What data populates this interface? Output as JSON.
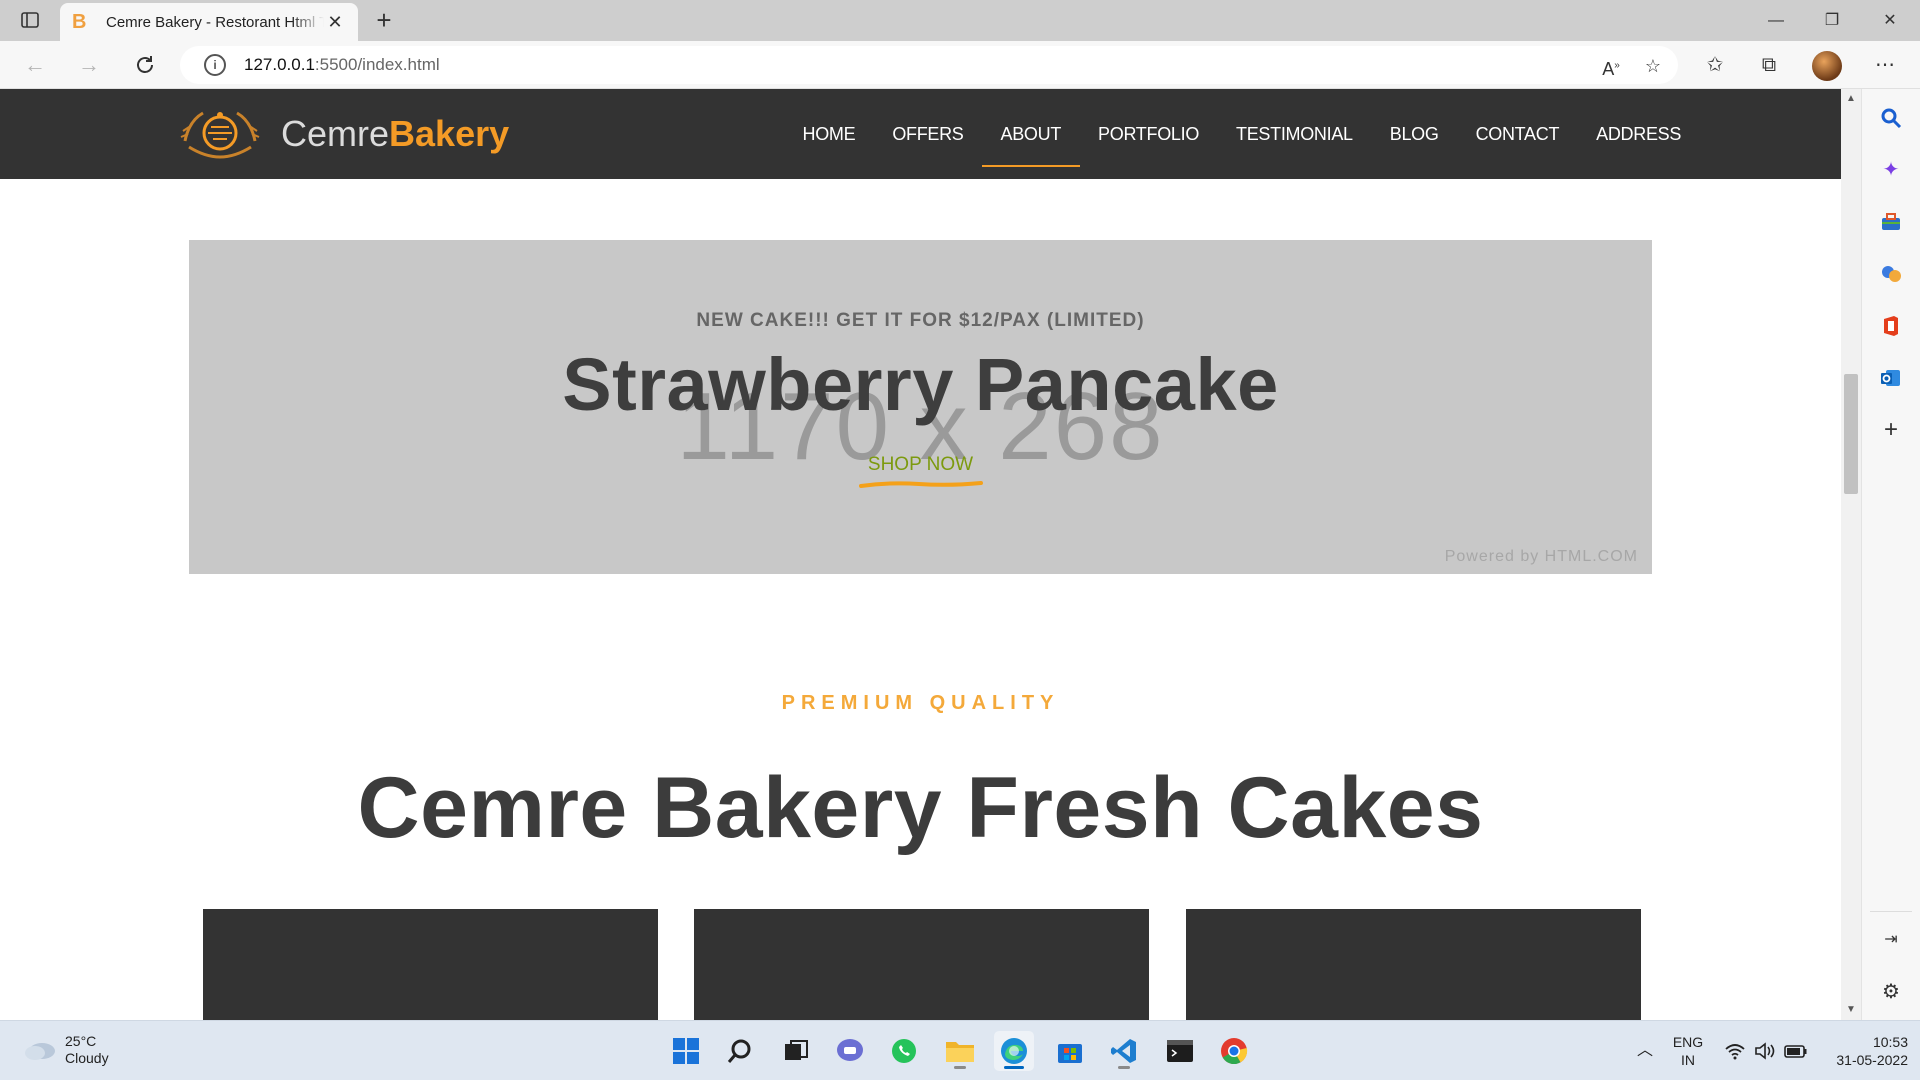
{
  "browser": {
    "tab_title": "Cemre Bakery - Restorant Html Template",
    "tab_favicon": "B",
    "url_host": "127.0.0.1",
    "url_path": ":5500/index.html"
  },
  "site": {
    "brand_light": "Cemre",
    "brand_bold": "Bakery",
    "menu": [
      {
        "label": "HOME"
      },
      {
        "label": "OFFERS"
      },
      {
        "label": "ABOUT",
        "active": true
      },
      {
        "label": "PORTFOLIO"
      },
      {
        "label": "TESTIMONIAL"
      },
      {
        "label": "BLOG"
      },
      {
        "label": "CONTACT"
      },
      {
        "label": "ADDRESS"
      }
    ],
    "banner": {
      "tag": "NEW CAKE!!! GET IT FOR $12/PAX (LIMITED)",
      "title": "Strawberry Pancake",
      "cta": "SHOP NOW",
      "placeholder_size": "1170 x 268",
      "placeholder_credit": "Powered by HTML.COM"
    },
    "section": {
      "eyebrow": "PREMIUM QUALITY",
      "title": "Cemre Bakery Fresh Cakes"
    }
  },
  "taskbar": {
    "weather_temp": "25°C",
    "weather_desc": "Cloudy",
    "lang1": "ENG",
    "lang2": "IN",
    "time": "10:53",
    "date": "31-05-2022"
  },
  "colors": {
    "nav_bg": "#333333",
    "accent_orange": "#f49b26",
    "eyebrow_orange": "#f4a93a",
    "cta_green": "#7c9a0e",
    "banner_bg": "#c8c8c8"
  }
}
